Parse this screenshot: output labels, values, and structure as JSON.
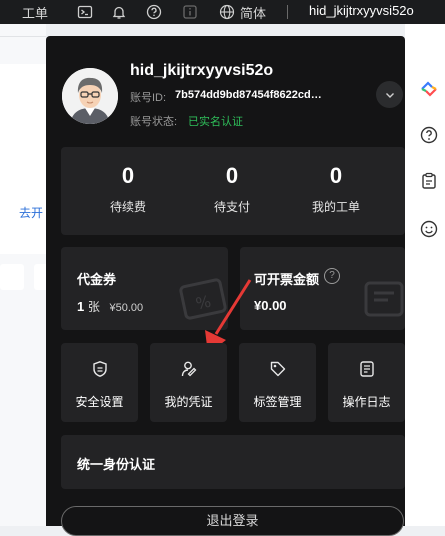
{
  "topbar": {
    "ticket_label": "工单",
    "language_label": "简体",
    "username": "hid_jkijtrxyyvsi52o",
    "icons": [
      "terminal-icon",
      "bell-icon",
      "help-icon",
      "info-icon",
      "globe-icon"
    ]
  },
  "background": {
    "link_text": "去开"
  },
  "account": {
    "username": "hid_jkijtrxyyvsi52o",
    "id_label": "账号ID:",
    "id_value": "7b574dd9bd87454f8622cd…",
    "status_label": "账号状态:",
    "status_value": "已实名认证"
  },
  "stats": [
    {
      "value": "0",
      "label": "待续费"
    },
    {
      "value": "0",
      "label": "待支付"
    },
    {
      "value": "0",
      "label": "我的工单"
    }
  ],
  "voucher": {
    "title": "代金券",
    "count": "1",
    "unit": "张",
    "amount": "¥50.00"
  },
  "invoice": {
    "title": "可开票金额",
    "amount": "¥0.00"
  },
  "tiles": [
    {
      "label": "安全设置",
      "icon": "shield-icon"
    },
    {
      "label": "我的凭证",
      "icon": "user-key-icon"
    },
    {
      "label": "标签管理",
      "icon": "tag-icon"
    },
    {
      "label": "操作日志",
      "icon": "document-icon"
    }
  ],
  "identity": {
    "title": "统一身份认证"
  },
  "logout_label": "退出登录",
  "colors": {
    "panel_bg": "#141415",
    "card_bg": "#232325",
    "verified_green": "#2fbf5a",
    "arrow_red": "#e53935",
    "link_blue": "#2b6fd8"
  }
}
